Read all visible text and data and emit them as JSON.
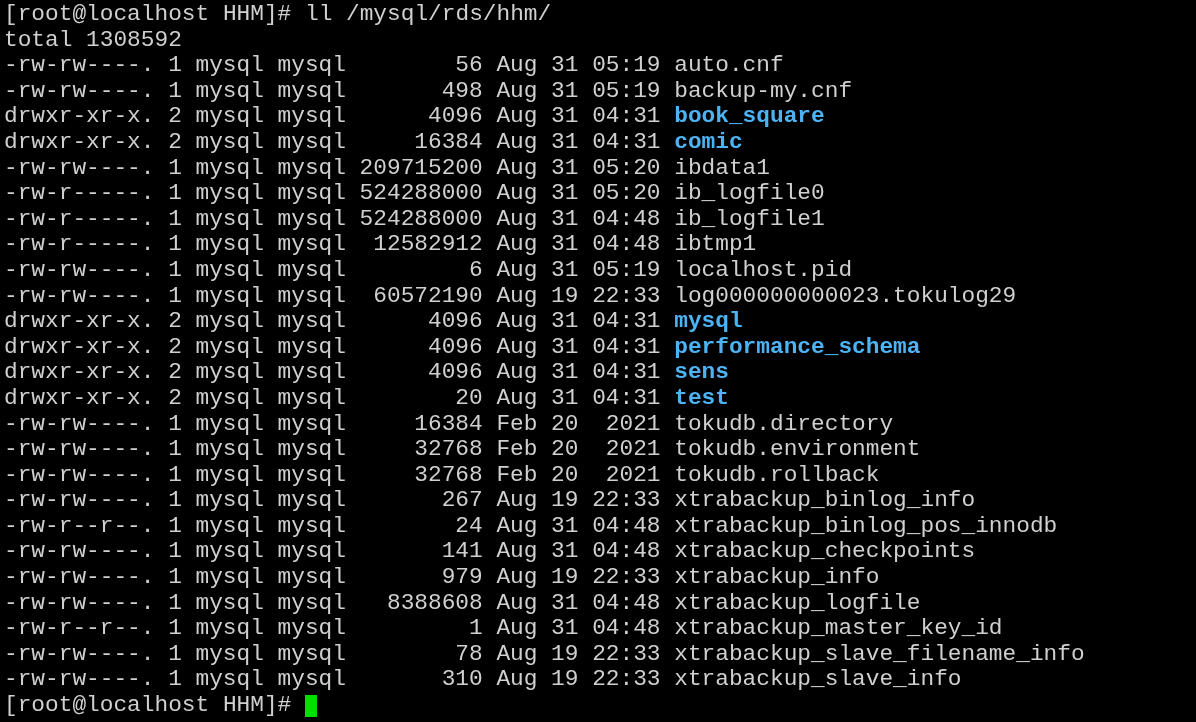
{
  "prompt": "[root@localhost HHM]# ",
  "command": "ll /mysql/rds/hhm/",
  "total": "total 1308592",
  "files": [
    {
      "permissions": "-rw-rw----.",
      "links": "1",
      "owner": "mysql",
      "group": "mysql",
      "size": "56",
      "date": "Aug 31 05:19",
      "name": "auto.cnf",
      "kind": "file"
    },
    {
      "permissions": "-rw-rw----.",
      "links": "1",
      "owner": "mysql",
      "group": "mysql",
      "size": "498",
      "date": "Aug 31 05:19",
      "name": "backup-my.cnf",
      "kind": "file"
    },
    {
      "permissions": "drwxr-xr-x.",
      "links": "2",
      "owner": "mysql",
      "group": "mysql",
      "size": "4096",
      "date": "Aug 31 04:31",
      "name": "book_square",
      "kind": "directory"
    },
    {
      "permissions": "drwxr-xr-x.",
      "links": "2",
      "owner": "mysql",
      "group": "mysql",
      "size": "16384",
      "date": "Aug 31 04:31",
      "name": "comic",
      "kind": "directory"
    },
    {
      "permissions": "-rw-rw----.",
      "links": "1",
      "owner": "mysql",
      "group": "mysql",
      "size": "209715200",
      "date": "Aug 31 05:20",
      "name": "ibdata1",
      "kind": "file"
    },
    {
      "permissions": "-rw-r-----.",
      "links": "1",
      "owner": "mysql",
      "group": "mysql",
      "size": "524288000",
      "date": "Aug 31 05:20",
      "name": "ib_logfile0",
      "kind": "file"
    },
    {
      "permissions": "-rw-r-----.",
      "links": "1",
      "owner": "mysql",
      "group": "mysql",
      "size": "524288000",
      "date": "Aug 31 04:48",
      "name": "ib_logfile1",
      "kind": "file"
    },
    {
      "permissions": "-rw-r-----.",
      "links": "1",
      "owner": "mysql",
      "group": "mysql",
      "size": "12582912",
      "date": "Aug 31 04:48",
      "name": "ibtmp1",
      "kind": "file"
    },
    {
      "permissions": "-rw-rw----.",
      "links": "1",
      "owner": "mysql",
      "group": "mysql",
      "size": "6",
      "date": "Aug 31 05:19",
      "name": "localhost.pid",
      "kind": "file"
    },
    {
      "permissions": "-rw-rw----.",
      "links": "1",
      "owner": "mysql",
      "group": "mysql",
      "size": "60572190",
      "date": "Aug 19 22:33",
      "name": "log000000000023.tokulog29",
      "kind": "file"
    },
    {
      "permissions": "drwxr-xr-x.",
      "links": "2",
      "owner": "mysql",
      "group": "mysql",
      "size": "4096",
      "date": "Aug 31 04:31",
      "name": "mysql",
      "kind": "directory"
    },
    {
      "permissions": "drwxr-xr-x.",
      "links": "2",
      "owner": "mysql",
      "group": "mysql",
      "size": "4096",
      "date": "Aug 31 04:31",
      "name": "performance_schema",
      "kind": "directory"
    },
    {
      "permissions": "drwxr-xr-x.",
      "links": "2",
      "owner": "mysql",
      "group": "mysql",
      "size": "4096",
      "date": "Aug 31 04:31",
      "name": "sens",
      "kind": "directory"
    },
    {
      "permissions": "drwxr-xr-x.",
      "links": "2",
      "owner": "mysql",
      "group": "mysql",
      "size": "20",
      "date": "Aug 31 04:31",
      "name": "test",
      "kind": "directory"
    },
    {
      "permissions": "-rw-rw----.",
      "links": "1",
      "owner": "mysql",
      "group": "mysql",
      "size": "16384",
      "date": "Feb 20  2021",
      "name": "tokudb.directory",
      "kind": "file"
    },
    {
      "permissions": "-rw-rw----.",
      "links": "1",
      "owner": "mysql",
      "group": "mysql",
      "size": "32768",
      "date": "Feb 20  2021",
      "name": "tokudb.environment",
      "kind": "file"
    },
    {
      "permissions": "-rw-rw----.",
      "links": "1",
      "owner": "mysql",
      "group": "mysql",
      "size": "32768",
      "date": "Feb 20  2021",
      "name": "tokudb.rollback",
      "kind": "file"
    },
    {
      "permissions": "-rw-rw----.",
      "links": "1",
      "owner": "mysql",
      "group": "mysql",
      "size": "267",
      "date": "Aug 19 22:33",
      "name": "xtrabackup_binlog_info",
      "kind": "file"
    },
    {
      "permissions": "-rw-r--r--.",
      "links": "1",
      "owner": "mysql",
      "group": "mysql",
      "size": "24",
      "date": "Aug 31 04:48",
      "name": "xtrabackup_binlog_pos_innodb",
      "kind": "file"
    },
    {
      "permissions": "-rw-rw----.",
      "links": "1",
      "owner": "mysql",
      "group": "mysql",
      "size": "141",
      "date": "Aug 31 04:48",
      "name": "xtrabackup_checkpoints",
      "kind": "file"
    },
    {
      "permissions": "-rw-rw----.",
      "links": "1",
      "owner": "mysql",
      "group": "mysql",
      "size": "979",
      "date": "Aug 19 22:33",
      "name": "xtrabackup_info",
      "kind": "file"
    },
    {
      "permissions": "-rw-rw----.",
      "links": "1",
      "owner": "mysql",
      "group": "mysql",
      "size": "8388608",
      "date": "Aug 31 04:48",
      "name": "xtrabackup_logfile",
      "kind": "file"
    },
    {
      "permissions": "-rw-r--r--.",
      "links": "1",
      "owner": "mysql",
      "group": "mysql",
      "size": "1",
      "date": "Aug 31 04:48",
      "name": "xtrabackup_master_key_id",
      "kind": "file"
    },
    {
      "permissions": "-rw-rw----.",
      "links": "1",
      "owner": "mysql",
      "group": "mysql",
      "size": "78",
      "date": "Aug 19 22:33",
      "name": "xtrabackup_slave_filename_info",
      "kind": "file"
    },
    {
      "permissions": "-rw-rw----.",
      "links": "1",
      "owner": "mysql",
      "group": "mysql",
      "size": "310",
      "date": "Aug 19 22:33",
      "name": "xtrabackup_slave_info",
      "kind": "file"
    }
  ],
  "final_prompt": "[root@localhost HHM]# "
}
